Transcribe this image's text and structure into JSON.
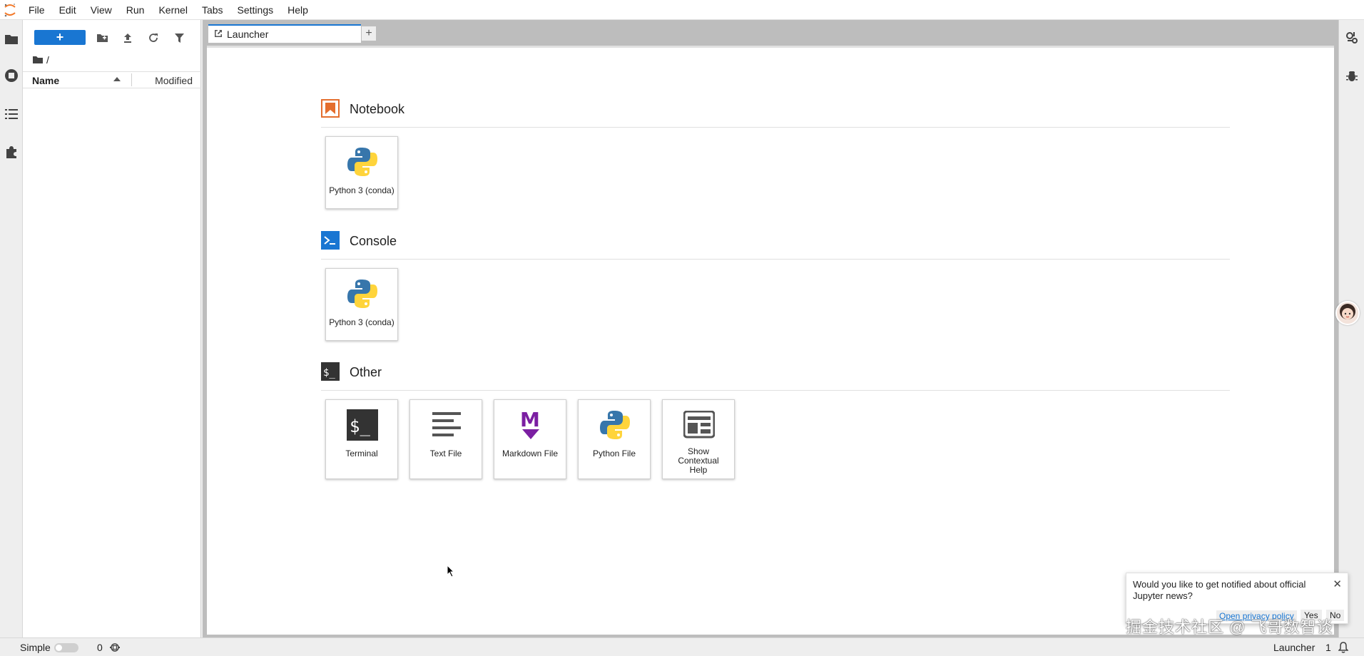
{
  "menubar": {
    "items": [
      "File",
      "Edit",
      "View",
      "Run",
      "Kernel",
      "Tabs",
      "Settings",
      "Help"
    ]
  },
  "leftbar": {
    "icons": [
      "folder-icon",
      "running-icon",
      "toc-icon",
      "extension-icon"
    ]
  },
  "filebrowser": {
    "new_label": "+",
    "breadcrumb": "/",
    "columns": {
      "name": "Name",
      "modified": "Modified"
    }
  },
  "tabs": [
    {
      "label": "Launcher",
      "active": true
    }
  ],
  "tab_add_label": "+",
  "launcher": {
    "sections": [
      {
        "title": "Notebook",
        "items": [
          {
            "label": "Python 3 (conda)"
          }
        ]
      },
      {
        "title": "Console",
        "items": [
          {
            "label": "Python 3 (conda)"
          }
        ]
      },
      {
        "title": "Other",
        "items": [
          {
            "label": "Terminal"
          },
          {
            "label": "Text File"
          },
          {
            "label": "Markdown File"
          },
          {
            "label": "Python File"
          },
          {
            "label": "Show Contextual Help"
          }
        ]
      }
    ]
  },
  "notification": {
    "message": "Would you like to get notified about official Jupyter news?",
    "link": "Open privacy policy",
    "yes": "Yes",
    "no": "No"
  },
  "watermark": "掘金技术社区 @ 飞哥数智谈",
  "statusbar": {
    "mode": "Simple",
    "kernels": "0",
    "active_tab": "Launcher",
    "notifications": "1"
  },
  "colors": {
    "accent": "#1976d2",
    "notebook_orange": "#e46e2e",
    "markdown_purple": "#7b1fa2",
    "terminal_dark": "#333333"
  }
}
